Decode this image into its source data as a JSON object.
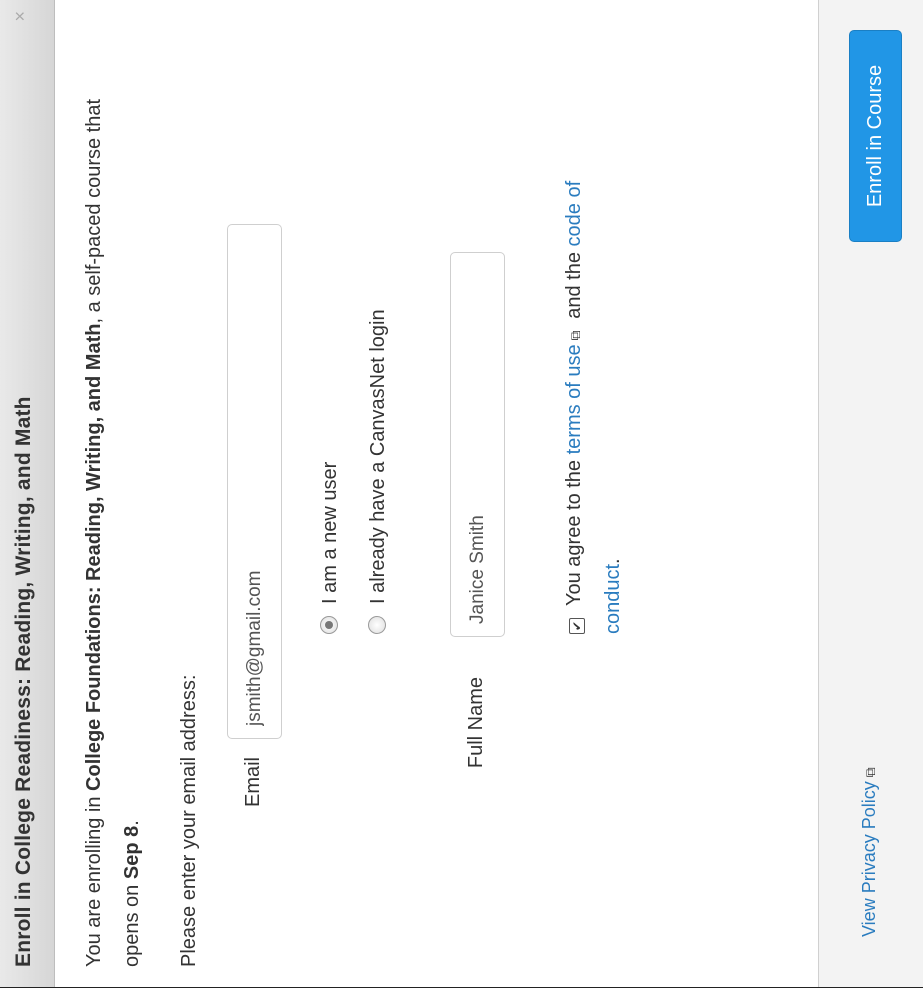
{
  "dialog": {
    "title": "Enroll in College Readiness: Reading, Writing, and Math",
    "close_symbol": "×"
  },
  "intro": {
    "prefix": "You are enrolling in ",
    "course_name": "College Foundations: Reading, Writing, and Math",
    "middle": ", a self-paced course that opens on ",
    "open_date": "Sep 8",
    "suffix": "."
  },
  "form": {
    "prompt": "Please enter your email address:",
    "email_label": "Email",
    "email_value": "jsmith@gmail.com",
    "radio_new_user": "I am a new user",
    "radio_existing_user": "I already have a CanvasNet login",
    "full_name_label": "Full Name",
    "full_name_value": "Janice Smith",
    "agree_prefix": "You agree to the ",
    "terms_link": "terms of use",
    "agree_middle": " and the ",
    "conduct_link": "code of conduct",
    "agree_suffix": ".",
    "checkbox_mark": "✔"
  },
  "footer": {
    "privacy_link": "View Privacy Policy",
    "enroll_button": "Enroll in Course"
  },
  "icons": {
    "external_link": "⧉"
  },
  "colors": {
    "accent": "#2196e6",
    "link": "#2a7cbf"
  }
}
